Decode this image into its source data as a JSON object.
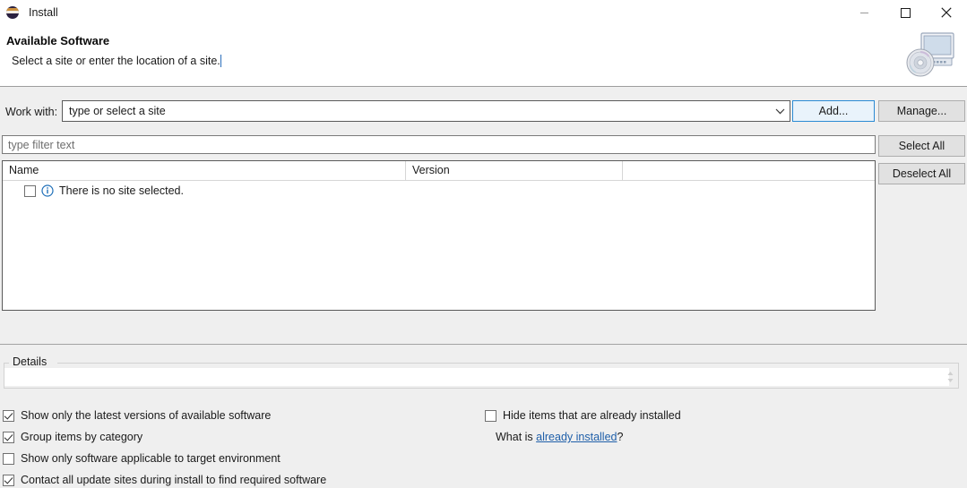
{
  "window": {
    "title": "Install",
    "icon": "eclipse-icon",
    "controls": {
      "minimize": "minimize-icon",
      "maximize": "maximize-icon",
      "close": "close-icon"
    }
  },
  "header": {
    "title": "Available Software",
    "description": "Select a site or enter the location of a site.",
    "graphic": "computer-with-disc-icon"
  },
  "work_with": {
    "label": "Work with:",
    "value": "type or select a site",
    "placeholder": "type or select a site",
    "dropdown_icon": "chevron-down-icon",
    "add_label": "Add...",
    "manage_label": "Manage..."
  },
  "filter": {
    "placeholder": "type filter text",
    "value": ""
  },
  "list_actions": {
    "select_all_label": "Select All",
    "deselect_all_label": "Deselect All"
  },
  "table": {
    "columns": [
      "Name",
      "Version",
      ""
    ],
    "rows": [
      {
        "checked": false,
        "icon": "info-icon",
        "name": "There is no site selected.",
        "version": ""
      }
    ]
  },
  "details": {
    "legend": "Details",
    "value": "",
    "grip_icon": "resize-grip-icon"
  },
  "options": {
    "left": [
      {
        "label": "Show only the latest versions of available software",
        "checked": true
      },
      {
        "label": "Group items by category",
        "checked": true
      },
      {
        "label": "Show only software applicable to target environment",
        "checked": false
      },
      {
        "label": "Contact all update sites during install to find required software",
        "checked": true
      }
    ],
    "right": [
      {
        "label": "Hide items that are already installed",
        "checked": false
      }
    ],
    "link_prefix": "What is ",
    "link_text": "already installed",
    "link_suffix": "?"
  },
  "colors": {
    "dialog_background": "#efefef",
    "white": "#ffffff",
    "default_button_border": "#2a8ad4",
    "default_button_fill": "#e9f3fb",
    "link": "#1f5fa9",
    "info_icon": "#1f6fb8",
    "caret": "#2a6ebb"
  }
}
